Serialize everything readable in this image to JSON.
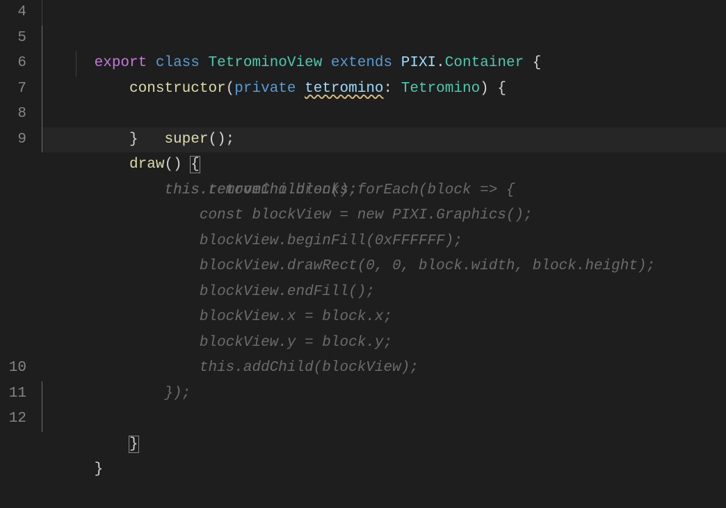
{
  "gutter": [
    "4",
    "5",
    "6",
    "7",
    "8",
    "9",
    "",
    "",
    "",
    "",
    "",
    "",
    "",
    "",
    "10",
    "11",
    "12"
  ],
  "tokens": {
    "l4": {
      "export": "export",
      "sp": " ",
      "class": "class",
      "name": "TetrominoView",
      "extends": "extends",
      "pixi": "PIXI",
      "dot": ".",
      "container": "Container",
      "ob": " {"
    },
    "l5": {
      "ctor": "constructor",
      "op": "(",
      "priv": "private",
      "sp": " ",
      "param": "tetromino",
      "colon": ": ",
      "type": "Tetromino",
      "cp": ")",
      "ob": " {"
    },
    "l6": {
      "super": "super",
      "call": "();"
    },
    "l7": {
      "cb": "}"
    },
    "l8": {
      "draw": "draw",
      "paren": "() ",
      "ob": "{"
    },
    "l9": {
      "txt": "this.removeChildren();"
    },
    "g1": {
      "txt": "this.tetromino.blocks.forEach(block => {"
    },
    "g2": {
      "txt": "const blockView = new PIXI.Graphics();"
    },
    "g3": {
      "txt": "blockView.beginFill(0xFFFFFF);"
    },
    "g4": {
      "txt": "blockView.drawRect(0, 0, block.width, block.height);"
    },
    "g5": {
      "txt": "blockView.endFill();"
    },
    "g6": {
      "txt": "blockView.x = block.x;"
    },
    "g7": {
      "txt": "blockView.y = block.y;"
    },
    "g8": {
      "txt": "this.addChild(blockView);"
    },
    "g9": {
      "txt": "});"
    },
    "l10": {
      "cb": "}"
    },
    "l12": {
      "cb": "}"
    }
  },
  "indent": {
    "unit": "    ",
    "i1": "    ",
    "i2": "        ",
    "i3": "            ",
    "i4": "                "
  }
}
